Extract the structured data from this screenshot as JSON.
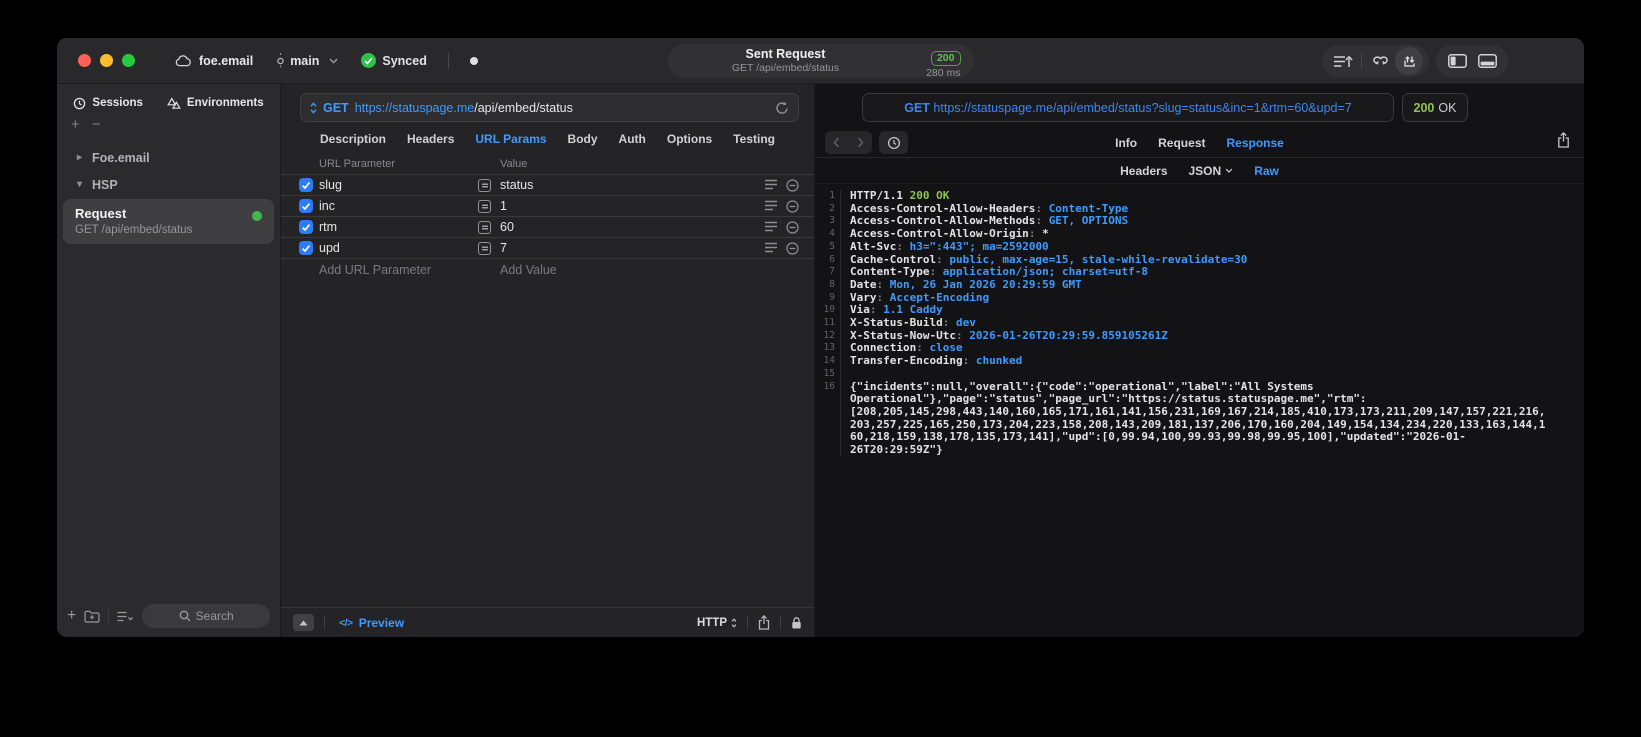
{
  "colors": {
    "accent": "#3e9bff",
    "green": "#32d74b",
    "status_green": "#8fc34f"
  },
  "titlebar": {
    "project_name": "foe.email",
    "branch_name": "main",
    "sync_label": "Synced",
    "request_summary": {
      "title": "Sent Request",
      "subtitle": "GET /api/embed/status",
      "status_code": "200",
      "duration": "280 ms"
    }
  },
  "sidebar": {
    "tabs": [
      {
        "label": "Sessions",
        "active": true
      },
      {
        "label": "Environments",
        "active": false
      }
    ],
    "groups": [
      {
        "label": "Foe.email",
        "expanded": false
      },
      {
        "label": "HSP",
        "expanded": true
      }
    ],
    "request_item": {
      "title": "Request",
      "subtitle": "GET /api/embed/status"
    },
    "search_placeholder": "Search"
  },
  "request_editor": {
    "method": "GET",
    "url_host": "https://statuspage.me",
    "url_path": "/api/embed/status",
    "tabs": [
      {
        "label": "Description",
        "active": false
      },
      {
        "label": "Headers",
        "active": false
      },
      {
        "label": "URL Params",
        "active": true
      },
      {
        "label": "Body",
        "active": false
      },
      {
        "label": "Auth",
        "active": false
      },
      {
        "label": "Options",
        "active": false
      },
      {
        "label": "Testing",
        "active": false
      }
    ],
    "params_table": {
      "col_name": "URL Parameter",
      "col_value": "Value",
      "rows": [
        {
          "name": "slug",
          "value": "status",
          "checked": true
        },
        {
          "name": "inc",
          "value": "1",
          "checked": true
        },
        {
          "name": "rtm",
          "value": "60",
          "checked": true
        },
        {
          "name": "upd",
          "value": "7",
          "checked": true
        }
      ],
      "add_name": "Add URL Parameter",
      "add_value": "Add Value"
    },
    "footer": {
      "preview_label": "Preview",
      "protocol_label": "HTTP"
    }
  },
  "response_viewer": {
    "request_line": "GET https://statuspage.me/api/embed/status?slug=status&inc=1&rtm=60&upd=7",
    "status_code": "200",
    "status_text": "OK",
    "tabs": [
      {
        "label": "Info",
        "active": false
      },
      {
        "label": "Request",
        "active": false
      },
      {
        "label": "Response",
        "active": true
      }
    ],
    "subtabs": [
      {
        "label": "Headers",
        "active": false,
        "dropdown": false
      },
      {
        "label": "JSON",
        "active": false,
        "dropdown": true
      },
      {
        "label": "Raw",
        "active": true,
        "dropdown": false
      }
    ],
    "status_line": {
      "protocol": "HTTP/1.1",
      "status": "200 OK"
    },
    "headers": [
      {
        "name": "Access-Control-Allow-Headers",
        "value": "Content-Type"
      },
      {
        "name": "Access-Control-Allow-Methods",
        "value": "GET, OPTIONS"
      },
      {
        "name": "Access-Control-Allow-Origin",
        "value": "*",
        "plain": true
      },
      {
        "name": "Alt-Svc",
        "value": "h3=\":443\"; ma=2592000"
      },
      {
        "name": "Cache-Control",
        "value": "public, max-age=15, stale-while-revalidate=30"
      },
      {
        "name": "Content-Type",
        "value": "application/json; charset=utf-8"
      },
      {
        "name": "Date",
        "value": "Mon, 26 Jan 2026 20:29:59 GMT"
      },
      {
        "name": "Vary",
        "value": "Accept-Encoding"
      },
      {
        "name": "Via",
        "value": "1.1 Caddy"
      },
      {
        "name": "X-Status-Build",
        "value": "dev"
      },
      {
        "name": "X-Status-Now-Utc",
        "value": "2026-01-26T20:29:59.859105261Z"
      },
      {
        "name": "Connection",
        "value": "close"
      },
      {
        "name": "Transfer-Encoding",
        "value": "chunked"
      }
    ],
    "body": "{\"incidents\":null,\"overall\":{\"code\":\"operational\",\"label\":\"All Systems Operational\"},\"page\":\"status\",\"page_url\":\"https://status.statuspage.me\",\"rtm\":[208,205,145,298,443,140,160,165,171,161,141,156,231,169,167,214,185,410,173,173,211,209,147,157,221,216,203,257,225,165,250,173,204,223,158,208,143,209,181,137,206,170,160,204,149,154,134,234,220,133,163,144,160,218,159,138,178,135,173,141],\"upd\":[0,99.94,100,99.93,99.98,99.95,100],\"updated\":\"2026-01-26T20:29:59Z\"}"
  }
}
